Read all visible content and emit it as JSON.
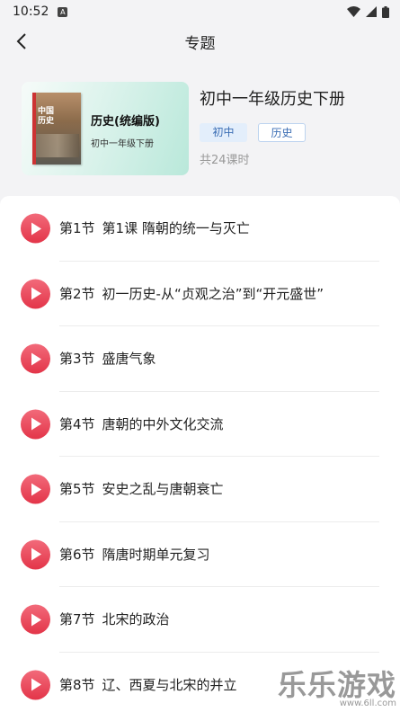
{
  "status_bar": {
    "time": "10:52",
    "notification_badge": "A"
  },
  "nav": {
    "title": "专题"
  },
  "book_card": {
    "title": "历史(统编版)",
    "subtitle": "初中一年级下册",
    "cover_title": "中国历史"
  },
  "book": {
    "title": "初中一年级历史下册",
    "tags": [
      "初中",
      "历史"
    ],
    "lesson_count": "共24课时"
  },
  "lessons": [
    {
      "no": "第1节",
      "title": "第1课 隋朝的统一与灭亡"
    },
    {
      "no": "第2节",
      "title": "初一历史-从“贞观之治”到“开元盛世”"
    },
    {
      "no": "第3节",
      "title": "盛唐气象"
    },
    {
      "no": "第4节",
      "title": "唐朝的中外文化交流"
    },
    {
      "no": "第5节",
      "title": "安史之乱与唐朝衰亡"
    },
    {
      "no": "第6节",
      "title": "隋唐时期单元复习"
    },
    {
      "no": "第7节",
      "title": "北宋的政治"
    },
    {
      "no": "第8节",
      "title": "辽、西夏与北宋的并立"
    }
  ],
  "watermark": {
    "main": "乐乐游戏",
    "sub": "www.6ll.com"
  },
  "colors": {
    "accent_red": "#e33549",
    "tag_blue": "#3a6db4"
  }
}
